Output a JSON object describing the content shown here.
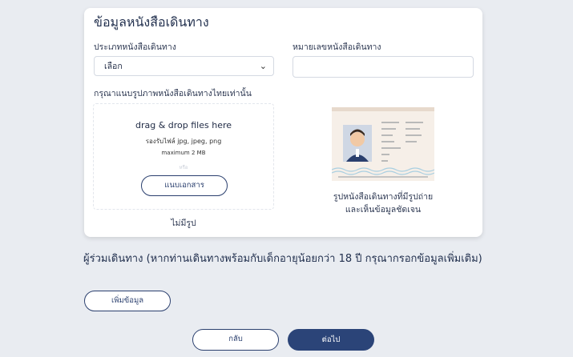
{
  "passport_section": {
    "title": "ข้อมูลหนังสือเดินทาง",
    "type_label": "ประเภทหนังสือเดินทาง",
    "type_value": "เลือก",
    "number_label": "หมายเลขหนังสือเดินทาง",
    "number_value": "",
    "upload_label": "กรุณาแนบรูปภาพหนังสือเดินทางไทยเท่านั้น",
    "dropzone": {
      "title": "drag & drop files here",
      "formats": "รองรับไฟล์ jpg, jpeg, png",
      "max_size": "maximum 2 MB",
      "or_text": "หรือ",
      "button": "แนบเอกสาร"
    },
    "no_image": "ไม่มีรูป",
    "sample_caption_line1": "รูปหนังสือเดินทางที่มีรูปถ่าย",
    "sample_caption_line2": "และเห็นข้อมูลชัดเจน",
    "icons": {
      "select_chevron": "chevron-down-icon"
    }
  },
  "companion": {
    "text": "ผู้ร่วมเดินทาง (หากท่านเดินทางพร้อมกับเด็กอายุน้อยกว่า 18 ปี กรุณากรอกข้อมูลเพิ่มเติม)",
    "add_button": "เพิ่มข้อมูล"
  },
  "nav": {
    "back": "กลับ",
    "next": "ต่อไป"
  },
  "colors": {
    "primary": "#2b4478",
    "background": "#e9ecf1",
    "card": "#ffffff"
  }
}
